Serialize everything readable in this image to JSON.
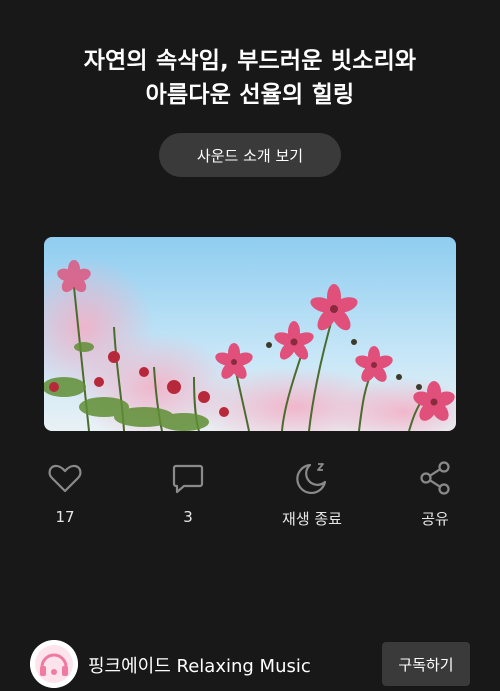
{
  "header": {
    "title_line1": "자연의 속삭임, 부드러운 빗소리와",
    "title_line2": "아름다운 선율의 힐링"
  },
  "intro_button": {
    "label": "사운드 소개 보기"
  },
  "hero_image": {
    "subject": "pink cosmos flowers against blue sky"
  },
  "actions": [
    {
      "icon": "heart-icon",
      "label": "17"
    },
    {
      "icon": "comment-icon",
      "label": "3"
    },
    {
      "icon": "sleep-timer-icon",
      "label": "재생 종료"
    },
    {
      "icon": "share-icon",
      "label": "공유"
    }
  ],
  "channel": {
    "name": "핑크에이드 Relaxing Music",
    "subscribe_label": "구독하기",
    "avatar_icon": "pink-aid-logo-icon"
  },
  "colors": {
    "background": "#181818",
    "button_bg": "#3a3a3a",
    "accent_pink": "#e0507a"
  }
}
